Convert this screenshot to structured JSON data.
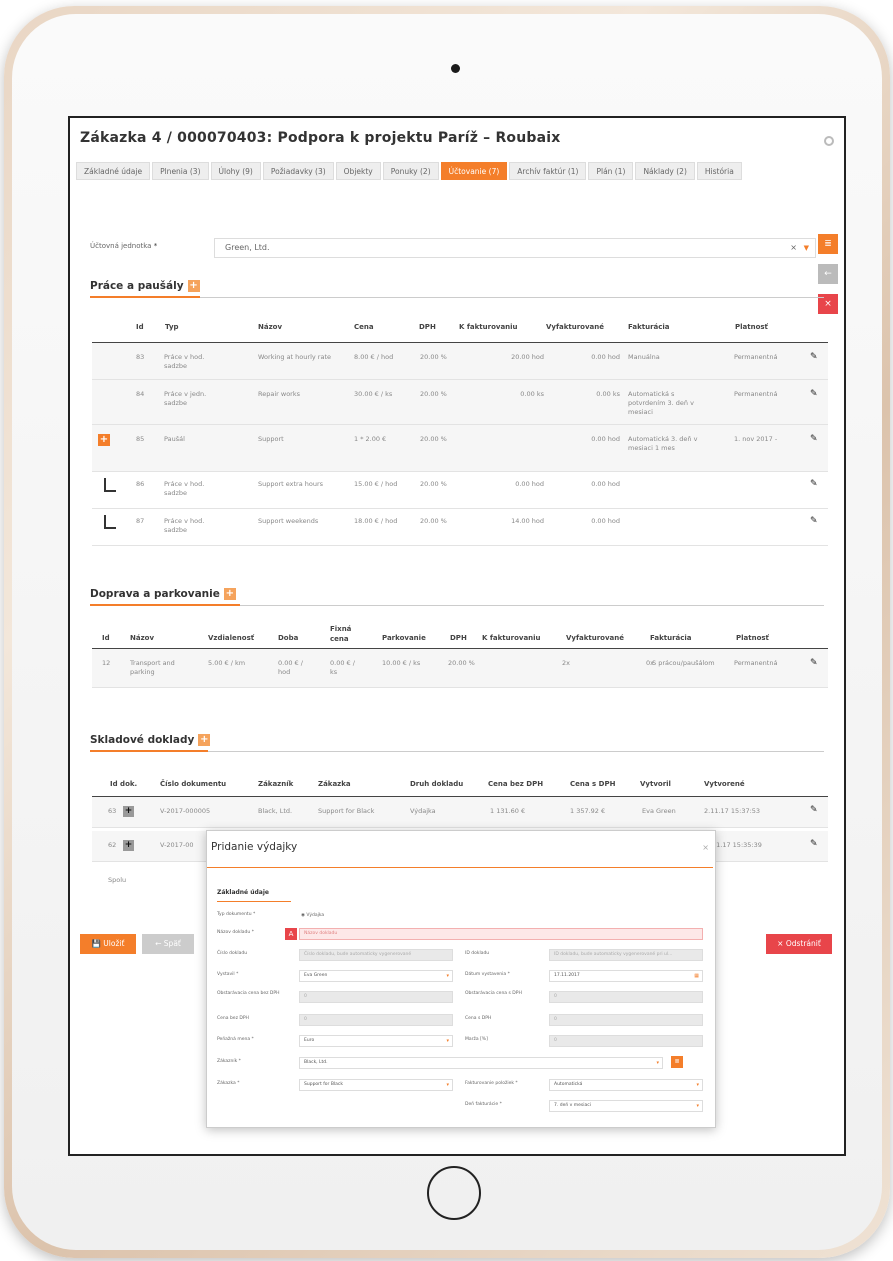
{
  "header": {
    "title": "Zákazka 4 / 000070403: Podpora k projektu Paríž – Roubaix"
  },
  "tabs": [
    {
      "label": "Základné údaje"
    },
    {
      "label": "Plnenia (3)"
    },
    {
      "label": "Úlohy (9)"
    },
    {
      "label": "Požiadavky (3)"
    },
    {
      "label": "Objekty"
    },
    {
      "label": "Ponuky (2)"
    },
    {
      "label": "Účtovanie (7)"
    },
    {
      "label": "Archív faktúr (1)"
    },
    {
      "label": "Plán (1)"
    },
    {
      "label": "Náklady (2)"
    },
    {
      "label": "História"
    }
  ],
  "accounting_unit": {
    "label": "Účtovná jednotka",
    "required": "*",
    "value": "Green, Ltd.",
    "clear": "×"
  },
  "work": {
    "heading": "Práce a paušály",
    "columns": [
      "Id",
      "Typ",
      "Názov",
      "Cena",
      "DPH",
      "K fakturovaniu",
      "Vyfakturované",
      "Fakturácia",
      "Platnosť"
    ],
    "rows": [
      [
        "83",
        "Práce v hod. sadzbe",
        "Working at hourly rate",
        "8.00 € / hod",
        "20.00 %",
        "20.00 hod",
        "0.00 hod",
        "Manuálna",
        "Permanentná"
      ],
      [
        "84",
        "Práce v jedn. sadzbe",
        "Repair works",
        "30.00 € / ks",
        "20.00 %",
        "0.00 ks",
        "0.00 ks",
        "Automatická s potvrdením 3. deň v mesiaci",
        "Permanentná"
      ],
      [
        "85",
        "Paušál",
        "Support",
        "1 * 2.00 €",
        "20.00 %",
        "",
        "0.00 hod",
        "Automatická 3. deň v mesiaci 1 mes",
        "1. nov 2017 -"
      ],
      [
        "86",
        "Práce v hod. sadzbe",
        "Support extra hours",
        "15.00 € / hod",
        "20.00 %",
        "0.00 hod",
        "0.00 hod",
        "",
        ""
      ],
      [
        "87",
        "Práce v hod. sadzbe",
        "Support weekends",
        "18.00 € / hod",
        "20.00 %",
        "14.00 hod",
        "0.00 hod",
        "",
        ""
      ]
    ]
  },
  "transport": {
    "heading": "Doprava a parkovanie",
    "columns": [
      "Id",
      "Názov",
      "Vzdialenosť",
      "Doba",
      "Fixná cena",
      "Parkovanie",
      "DPH",
      "K fakturovaniu",
      "Vyfakturované",
      "Fakturácia",
      "Platnosť"
    ],
    "rows": [
      [
        "12",
        "Transport and parking",
        "5.00 € / km",
        "0.00 € / hod",
        "0.00 € / ks",
        "10.00 € / ks",
        "20.00 %",
        "2x",
        "0x",
        "S prácou/paušálom",
        "Permanentná"
      ]
    ]
  },
  "stock": {
    "heading": "Skladové doklady",
    "columns": [
      "Id dok.",
      "Číslo dokumentu",
      "Zákazník",
      "Zákazka",
      "Druh dokladu",
      "Cena bez DPH",
      "Cena s DPH",
      "Vytvoril",
      "Vytvorené"
    ],
    "rows": [
      [
        "63",
        "V-2017-000005",
        "Black, Ltd.",
        "Support for Black",
        "Výdajka",
        "1 131.60 €",
        "1 357.92 €",
        "Eva Green",
        "2.11.17 15:37:53"
      ],
      [
        "62",
        "V-2017-00",
        "",
        "",
        "",
        "",
        "",
        "",
        "11.17 15:35:39"
      ]
    ],
    "sum_label": "Spolu"
  },
  "buttons": {
    "save": "Uložiť",
    "back": "← Späť",
    "delete": "× Odstrániť"
  },
  "modal": {
    "title": "Pridanie výdajky",
    "section": "Základné údaje",
    "doc_type_label": "Typ dokumentu",
    "doc_type_value": "Výdajka",
    "name_label": "Názov dokladu",
    "name_placeholder": "Názov dokladu",
    "number_label": "Číslo dokladu",
    "number_placeholder": "Číslo dokladu, bude automaticky vygenerované",
    "id_label": "ID dokladu",
    "id_placeholder": "ID dokladu, bude automaticky vygenerované pri ul...",
    "issued_by_label": "Vystavil",
    "issued_by_value": "Eva Green",
    "issue_date_label": "Dátum vystavenia",
    "issue_date_value": "17.11.2017",
    "price_without_label": "Obstarávacia cena bez DPH",
    "price_without_value": "0",
    "price_with_label": "Obstarávacia cena s DPH",
    "price_with_value": "0",
    "net_label": "Cena bez DPH",
    "net_value": "0",
    "gross_label": "Cena s DPH",
    "gross_value": "0",
    "currency_label": "Peňažná mena",
    "currency_value": "Euro",
    "margin_label": "Marža [%]",
    "margin_value": "0",
    "customer_label": "Zákazník",
    "customer_value": "Black, Ltd.",
    "order_label": "Zákazka",
    "order_value": "Support for Black",
    "billing_label": "Fakturovanie položiek",
    "billing_value": "Automatická",
    "billing_day_label": "Deň fakturácie",
    "billing_day_value": "7. deň v mesiaci",
    "close": "×",
    "required": "*"
  },
  "colors": {
    "accent": "#f47e2a",
    "danger": "#e8454a"
  }
}
